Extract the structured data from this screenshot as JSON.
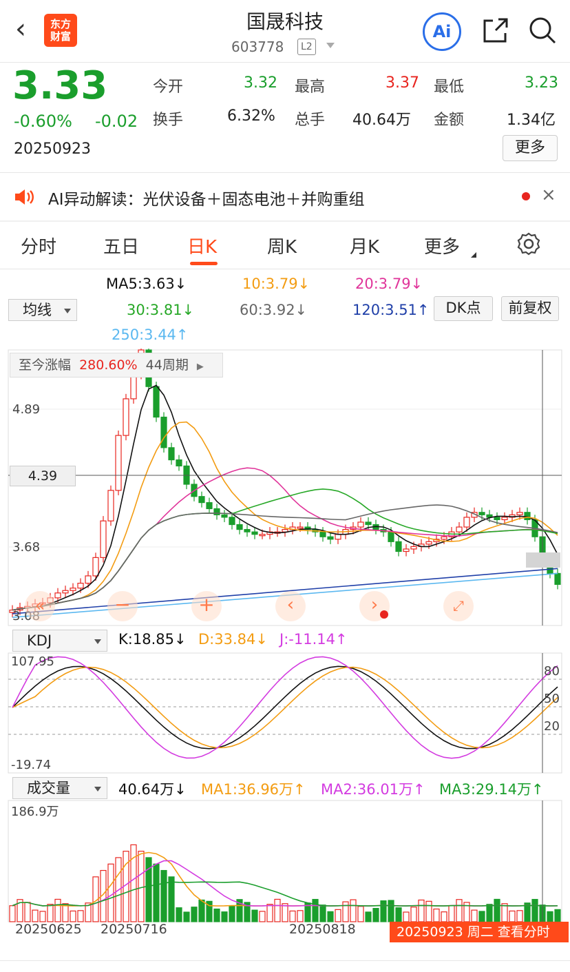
{
  "header": {
    "back_icon": "chevron-left-icon",
    "logo_text": "东方\n财富",
    "title": "国晟科技",
    "code": "603778",
    "level": "L2",
    "ai_label": "Ai"
  },
  "quote": {
    "price": "3.33",
    "pct": "-0.60%",
    "chg": "-0.02",
    "date": "20250923",
    "fields": [
      {
        "label": "今开",
        "value": "3.32",
        "color": "#1a9e2c"
      },
      {
        "label": "最高",
        "value": "3.37",
        "color": "#e8251f"
      },
      {
        "label": "最低",
        "value": "3.23",
        "color": "#1a9e2c"
      },
      {
        "label": "换手",
        "value": "6.32%",
        "color": "#222222"
      },
      {
        "label": "总手",
        "value": "40.64万",
        "color": "#222222"
      },
      {
        "label": "金额",
        "value": "1.34亿",
        "color": "#222222"
      }
    ],
    "more": "更多"
  },
  "notice": {
    "text": "AI异动解读：光伏设备＋固态电池＋并购重组",
    "close": "×"
  },
  "tabs": [
    "分时",
    "五日",
    "日K",
    "周K",
    "月K",
    "更多"
  ],
  "active_tab": "日K",
  "ma_panel": {
    "selector": "均线",
    "ma5": "MA5:3.63↓",
    "ma10": "10:3.79↓",
    "ma20": "20:3.79↓",
    "ma30": "30:3.81↓",
    "ma60": "60:3.92↓",
    "ma120": "120:3.51↑",
    "ma250": "250:3.44↑",
    "dk_button": "DK点",
    "fq_button": "前复权"
  },
  "colors": {
    "up": "#e8251f",
    "down": "#1a9e2c",
    "accent": "#ff4a1a",
    "ma5": "#111111",
    "ma10": "#f39c12",
    "ma20": "#e0349a",
    "ma30": "#27a827",
    "ma60": "#666666",
    "ma120": "#1f3fa8",
    "ma250": "#5bb8f0"
  },
  "kline": {
    "since_label": "至今涨幅",
    "since_value": "280.60%",
    "since_period": "44周期",
    "price_ticks": [
      "4.89",
      "4.39",
      "3.68",
      "3.08"
    ],
    "crosshair_price": "4.39"
  },
  "kdj": {
    "selector": "KDJ",
    "k": "K:18.85↓",
    "d": "D:33.84↓",
    "j": "J:-11.14↑",
    "ticks": [
      "107.95",
      "-19.74"
    ],
    "levels": [
      "80",
      "50",
      "20"
    ]
  },
  "volume": {
    "selector": "成交量",
    "value": "40.64万↓",
    "ma1": "MA1:36.96万↑",
    "ma2": "MA2:36.01万↑",
    "ma3": "MA3:29.14万↑",
    "top_tick": "186.9万"
  },
  "dates": [
    "20250625",
    "20250716",
    "20250818"
  ],
  "cursor_label": "20250923 周二 查看分时"
}
